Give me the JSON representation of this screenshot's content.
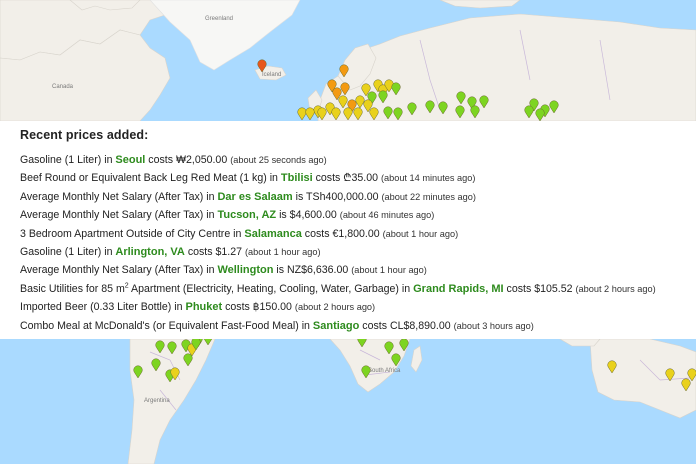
{
  "map_labels": {
    "greenland": "Greenland",
    "iceland": "Iceland",
    "canada": "Canada",
    "south_africa": "South Africa",
    "argentina": "Argentina"
  },
  "colors": {
    "ocean": "#aadaff",
    "land": "#f2efe9",
    "green_marker": "#7dd421",
    "yellow_marker": "#e9d11c",
    "orange_marker": "#f39a12",
    "red_marker": "#e7561c",
    "city_link": "#2e8b1e"
  },
  "panel": {
    "title": "Recent prices added:",
    "rows": [
      {
        "item": "Gasoline (1 Liter)",
        "mid": " in ",
        "city": "Seoul",
        "verb": " costs ",
        "price": "₩2,050.00",
        "ago": "(about 25 seconds ago)"
      },
      {
        "item": "Beef Round or Equivalent Back Leg Red Meat (1 kg)",
        "mid": " in ",
        "city": "Tbilisi",
        "verb": " costs ",
        "price": "₾35.00",
        "ago": "(about 14 minutes ago)"
      },
      {
        "item": "Average Monthly Net Salary (After Tax)",
        "mid": " in ",
        "city": "Dar es Salaam",
        "verb": " is ",
        "price": "TSh400,000.00",
        "ago": "(about 22 minutes ago)"
      },
      {
        "item": "Average Monthly Net Salary (After Tax)",
        "mid": " in ",
        "city": "Tucson, AZ",
        "verb": " is ",
        "price": "$4,600.00",
        "ago": "(about 46 minutes ago)"
      },
      {
        "item": "3 Bedroom Apartment Outside of City Centre",
        "mid": " in ",
        "city": "Salamanca",
        "verb": " costs ",
        "price": "€1,800.00",
        "ago": "(about 1 hour ago)"
      },
      {
        "item": "Gasoline (1 Liter)",
        "mid": " in ",
        "city": "Arlington, VA",
        "verb": " costs ",
        "price": "$1.27",
        "ago": "(about 1 hour ago)"
      },
      {
        "item": "Average Monthly Net Salary (After Tax)",
        "mid": " in ",
        "city": "Wellington",
        "verb": " is ",
        "price": "NZ$6,636.00",
        "ago": "(about 1 hour ago)"
      },
      {
        "item_pre": "Basic Utilities for 85 m",
        "item_sup": "2",
        "item_post": " Apartment (Electricity, Heating, Cooling, Water, Garbage)",
        "mid": " in ",
        "city": "Grand Rapids, MI",
        "verb": " costs ",
        "price": "$105.52",
        "ago": "(about 2 hours ago)"
      },
      {
        "item": "Imported Beer (0.33 Liter Bottle)",
        "mid": " in ",
        "city": "Phuket",
        "verb": " costs ",
        "price": "฿150.00",
        "ago": "(about 2 hours ago)"
      },
      {
        "item": "Combo Meal at McDonald's (or Equivalent Fast-Food Meal)",
        "mid": " in ",
        "city": "Santiago",
        "verb": " costs ",
        "price": "CL$8,890.00",
        "ago": "(about 3 hours ago)"
      }
    ]
  }
}
